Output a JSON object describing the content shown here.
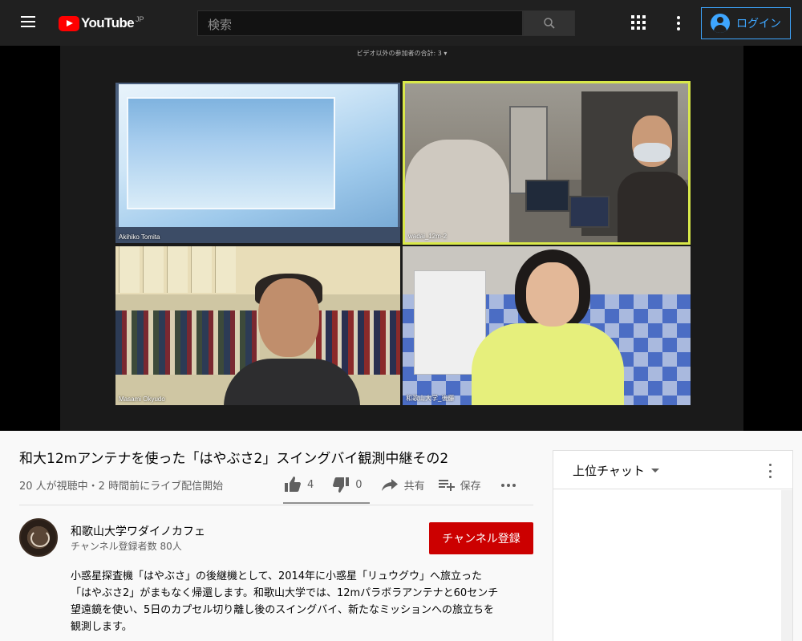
{
  "header": {
    "logo_text": "YouTube",
    "logo_region": "JP",
    "search_placeholder": "検索",
    "login_label": "ログイン"
  },
  "video": {
    "zoom_header": "ビデオ以外の参加者の合計: 3 ▾",
    "participants": [
      {
        "name": "Akihiko Tomita"
      },
      {
        "name": "wadai_12m-2"
      },
      {
        "name": "Masami Okyudo"
      },
      {
        "name": "和歌山大学_後藤"
      }
    ]
  },
  "info": {
    "title": "和大12mアンテナを使った「はやぶさ2」スイングバイ観測中継その2",
    "meta": "20 人が視聴中・2 時間前にライブ配信開始",
    "likes": "4",
    "dislikes": "0",
    "share_label": "共有",
    "save_label": "保存"
  },
  "channel": {
    "name": "和歌山大学ワダイノカフェ",
    "subscribers": "チャンネル登録者数 80人",
    "subscribe_label": "チャンネル登録"
  },
  "description": {
    "lines": [
      "小惑星探査機「はやぶさ」の後継機として、2014年に小惑星「リュウグウ」へ旅立った",
      "「はやぶさ2」がまもなく帰還します。和歌山大学では、12mパラボラアンテナと60センチ",
      "望遠鏡を使い、5日のカプセル切り離し後のスイングバイ、新たなミッションへの旅立ちを",
      "観測します。"
    ]
  },
  "chat": {
    "mode_label": "上位チャット"
  },
  "colors": {
    "header_bg": "#202020",
    "accent_blue": "#3ea6ff",
    "subscribe_red": "#cc0000",
    "logo_red": "#ff0000",
    "active_speaker": "#d9e84a"
  },
  "icons": [
    "menu-icon",
    "youtube-logo-icon",
    "search-icon",
    "apps-icon",
    "more-vert-icon",
    "account-icon",
    "like-icon",
    "dislike-icon",
    "share-icon",
    "save-playlist-icon",
    "more-horiz-icon",
    "caret-down-icon"
  ]
}
